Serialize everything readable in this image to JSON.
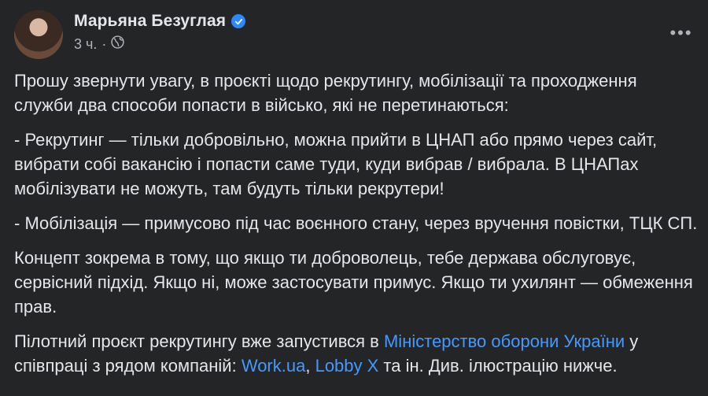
{
  "post": {
    "author": "Марьяна Безуглая",
    "time": "3 ч.",
    "separator": "·",
    "more_label": "•••",
    "icons": {
      "verified": "verified-badge-icon",
      "audience": "globe-icon",
      "more": "more-options-icon"
    },
    "colors": {
      "background": "#242526",
      "text": "#e4e6eb",
      "muted": "#b0b3b8",
      "link": "#4599ff",
      "verified": "#2d88ff"
    },
    "paragraphs": [
      "Прошу звернути увагу, в проєкті щодо рекрутингу, мобілізації та проходження служби два способи попасти в військо, які не перетинаються:",
      "- Рекрутинг — тільки добровільно, можна прийти в ЦНАП або прямо через сайт, вибрати собі вакансію і попасти саме туди, куди вибрав / вибрала. В ЦНАПах мобілізувати не можуть, там будуть тільки рекрутери!",
      "- Мобілізація — примусово під час воєнного стану, через вручення повістки, ТЦК СП.",
      "Концепт зокрема в тому, що якщо ти доброволець, тебе держава обслуговує, сервісний підхід. Якщо ні, може застосувати примус. Якщо ти ухилянт — обмеження прав."
    ],
    "last_paragraph": {
      "text1": "Пілотний проєкт рекрутингу вже запустився в ",
      "link1": "Міністерство оборони України",
      "text2": " у співпраці з рядом компаній: ",
      "link2": "Work.ua",
      "text3": ", ",
      "link3": "Lobby X",
      "text4": " та ін. Див. ілюстрацію нижче."
    }
  }
}
